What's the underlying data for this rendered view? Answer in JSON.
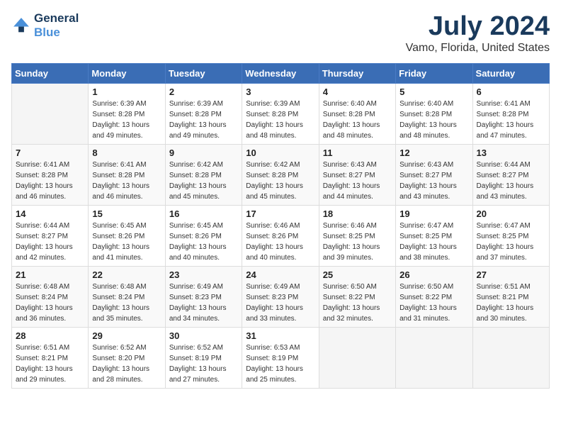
{
  "logo": {
    "line1": "General",
    "line2": "Blue"
  },
  "title": "July 2024",
  "subtitle": "Vamo, Florida, United States",
  "days_header": [
    "Sunday",
    "Monday",
    "Tuesday",
    "Wednesday",
    "Thursday",
    "Friday",
    "Saturday"
  ],
  "weeks": [
    [
      {
        "day": "",
        "sunrise": "",
        "sunset": "",
        "daylight": ""
      },
      {
        "day": "1",
        "sunrise": "Sunrise: 6:39 AM",
        "sunset": "Sunset: 8:28 PM",
        "daylight": "Daylight: 13 hours and 49 minutes."
      },
      {
        "day": "2",
        "sunrise": "Sunrise: 6:39 AM",
        "sunset": "Sunset: 8:28 PM",
        "daylight": "Daylight: 13 hours and 49 minutes."
      },
      {
        "day": "3",
        "sunrise": "Sunrise: 6:39 AM",
        "sunset": "Sunset: 8:28 PM",
        "daylight": "Daylight: 13 hours and 48 minutes."
      },
      {
        "day": "4",
        "sunrise": "Sunrise: 6:40 AM",
        "sunset": "Sunset: 8:28 PM",
        "daylight": "Daylight: 13 hours and 48 minutes."
      },
      {
        "day": "5",
        "sunrise": "Sunrise: 6:40 AM",
        "sunset": "Sunset: 8:28 PM",
        "daylight": "Daylight: 13 hours and 48 minutes."
      },
      {
        "day": "6",
        "sunrise": "Sunrise: 6:41 AM",
        "sunset": "Sunset: 8:28 PM",
        "daylight": "Daylight: 13 hours and 47 minutes."
      }
    ],
    [
      {
        "day": "7",
        "sunrise": "Sunrise: 6:41 AM",
        "sunset": "Sunset: 8:28 PM",
        "daylight": "Daylight: 13 hours and 46 minutes."
      },
      {
        "day": "8",
        "sunrise": "Sunrise: 6:41 AM",
        "sunset": "Sunset: 8:28 PM",
        "daylight": "Daylight: 13 hours and 46 minutes."
      },
      {
        "day": "9",
        "sunrise": "Sunrise: 6:42 AM",
        "sunset": "Sunset: 8:28 PM",
        "daylight": "Daylight: 13 hours and 45 minutes."
      },
      {
        "day": "10",
        "sunrise": "Sunrise: 6:42 AM",
        "sunset": "Sunset: 8:28 PM",
        "daylight": "Daylight: 13 hours and 45 minutes."
      },
      {
        "day": "11",
        "sunrise": "Sunrise: 6:43 AM",
        "sunset": "Sunset: 8:27 PM",
        "daylight": "Daylight: 13 hours and 44 minutes."
      },
      {
        "day": "12",
        "sunrise": "Sunrise: 6:43 AM",
        "sunset": "Sunset: 8:27 PM",
        "daylight": "Daylight: 13 hours and 43 minutes."
      },
      {
        "day": "13",
        "sunrise": "Sunrise: 6:44 AM",
        "sunset": "Sunset: 8:27 PM",
        "daylight": "Daylight: 13 hours and 43 minutes."
      }
    ],
    [
      {
        "day": "14",
        "sunrise": "Sunrise: 6:44 AM",
        "sunset": "Sunset: 8:27 PM",
        "daylight": "Daylight: 13 hours and 42 minutes."
      },
      {
        "day": "15",
        "sunrise": "Sunrise: 6:45 AM",
        "sunset": "Sunset: 8:26 PM",
        "daylight": "Daylight: 13 hours and 41 minutes."
      },
      {
        "day": "16",
        "sunrise": "Sunrise: 6:45 AM",
        "sunset": "Sunset: 8:26 PM",
        "daylight": "Daylight: 13 hours and 40 minutes."
      },
      {
        "day": "17",
        "sunrise": "Sunrise: 6:46 AM",
        "sunset": "Sunset: 8:26 PM",
        "daylight": "Daylight: 13 hours and 40 minutes."
      },
      {
        "day": "18",
        "sunrise": "Sunrise: 6:46 AM",
        "sunset": "Sunset: 8:25 PM",
        "daylight": "Daylight: 13 hours and 39 minutes."
      },
      {
        "day": "19",
        "sunrise": "Sunrise: 6:47 AM",
        "sunset": "Sunset: 8:25 PM",
        "daylight": "Daylight: 13 hours and 38 minutes."
      },
      {
        "day": "20",
        "sunrise": "Sunrise: 6:47 AM",
        "sunset": "Sunset: 8:25 PM",
        "daylight": "Daylight: 13 hours and 37 minutes."
      }
    ],
    [
      {
        "day": "21",
        "sunrise": "Sunrise: 6:48 AM",
        "sunset": "Sunset: 8:24 PM",
        "daylight": "Daylight: 13 hours and 36 minutes."
      },
      {
        "day": "22",
        "sunrise": "Sunrise: 6:48 AM",
        "sunset": "Sunset: 8:24 PM",
        "daylight": "Daylight: 13 hours and 35 minutes."
      },
      {
        "day": "23",
        "sunrise": "Sunrise: 6:49 AM",
        "sunset": "Sunset: 8:23 PM",
        "daylight": "Daylight: 13 hours and 34 minutes."
      },
      {
        "day": "24",
        "sunrise": "Sunrise: 6:49 AM",
        "sunset": "Sunset: 8:23 PM",
        "daylight": "Daylight: 13 hours and 33 minutes."
      },
      {
        "day": "25",
        "sunrise": "Sunrise: 6:50 AM",
        "sunset": "Sunset: 8:22 PM",
        "daylight": "Daylight: 13 hours and 32 minutes."
      },
      {
        "day": "26",
        "sunrise": "Sunrise: 6:50 AM",
        "sunset": "Sunset: 8:22 PM",
        "daylight": "Daylight: 13 hours and 31 minutes."
      },
      {
        "day": "27",
        "sunrise": "Sunrise: 6:51 AM",
        "sunset": "Sunset: 8:21 PM",
        "daylight": "Daylight: 13 hours and 30 minutes."
      }
    ],
    [
      {
        "day": "28",
        "sunrise": "Sunrise: 6:51 AM",
        "sunset": "Sunset: 8:21 PM",
        "daylight": "Daylight: 13 hours and 29 minutes."
      },
      {
        "day": "29",
        "sunrise": "Sunrise: 6:52 AM",
        "sunset": "Sunset: 8:20 PM",
        "daylight": "Daylight: 13 hours and 28 minutes."
      },
      {
        "day": "30",
        "sunrise": "Sunrise: 6:52 AM",
        "sunset": "Sunset: 8:19 PM",
        "daylight": "Daylight: 13 hours and 27 minutes."
      },
      {
        "day": "31",
        "sunrise": "Sunrise: 6:53 AM",
        "sunset": "Sunset: 8:19 PM",
        "daylight": "Daylight: 13 hours and 25 minutes."
      },
      {
        "day": "",
        "sunrise": "",
        "sunset": "",
        "daylight": ""
      },
      {
        "day": "",
        "sunrise": "",
        "sunset": "",
        "daylight": ""
      },
      {
        "day": "",
        "sunrise": "",
        "sunset": "",
        "daylight": ""
      }
    ]
  ]
}
